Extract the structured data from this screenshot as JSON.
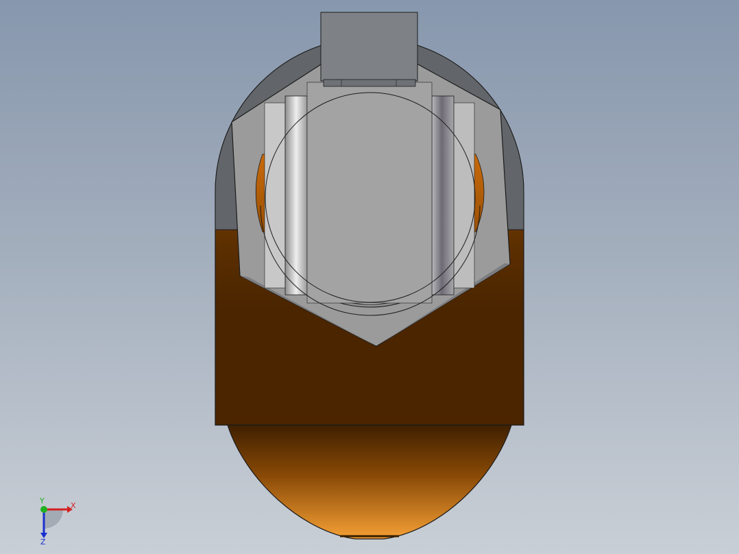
{
  "viewport": {
    "background_top": "#8797ad",
    "background_bottom": "#c9cfd6"
  },
  "model": {
    "body_color": "#5a2e00",
    "body_highlight": "#f39a2e",
    "nut_color": "#9b9b9b",
    "nut_dark": "#6b6d70",
    "bore_color": "#a2a2a2"
  },
  "triad": {
    "x_label": "X",
    "y_label": "Y",
    "z_label": "Z",
    "x_color": "#d42020",
    "y_color": "#20b020",
    "z_color": "#1a2fd0"
  }
}
